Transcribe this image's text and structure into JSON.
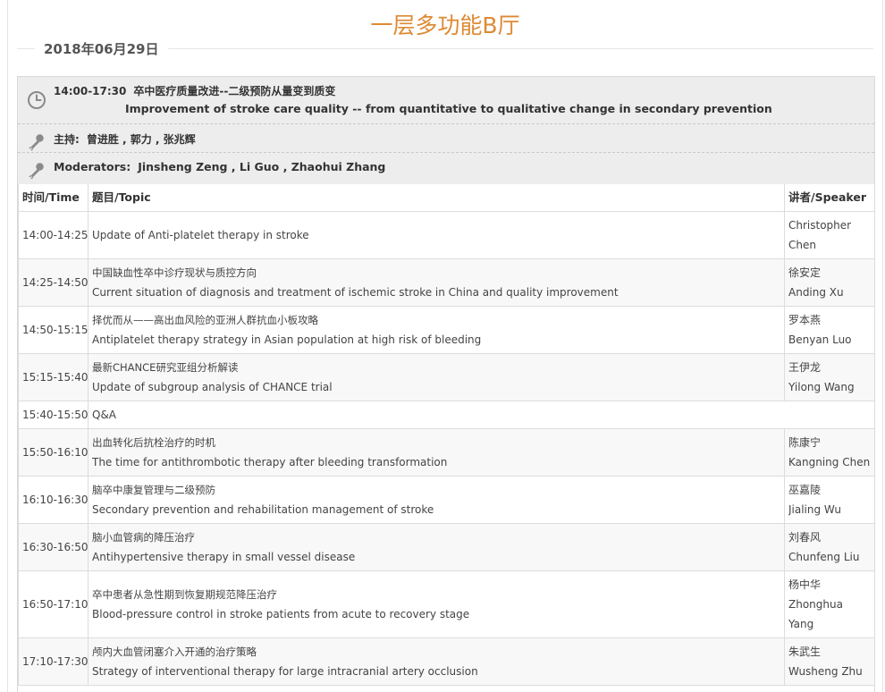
{
  "hall": {
    "title": "一层多功能B厅"
  },
  "date": {
    "label": "2018年06月29日"
  },
  "session": {
    "time": "14:00-17:30",
    "title_cn": "卒中医疗质量改进--二级预防从量变到质变",
    "title_en": "Improvement of stroke care quality -- from quantitative to qualitative change in secondary prevention",
    "host_label": "主持:",
    "hosts_cn": "曾进胜 , 郭力 , 张兆辉",
    "moderators_label": "Moderators:",
    "moderators_en": "Jinsheng Zeng , Li Guo , Zhaohui Zhang",
    "icons": {
      "time": "clock-icon",
      "host": "microphone-icon",
      "moderators": "microphone-icon"
    }
  },
  "table": {
    "headers": {
      "time": "时间/Time",
      "topic": "题目/Topic",
      "speaker": "讲者/Speaker"
    },
    "rows": [
      {
        "time": "14:00-14:25",
        "topic_cn": "",
        "topic_en": "Update of Anti-platelet therapy in stroke",
        "speaker_cn": "",
        "speaker_en": "Christopher Chen"
      },
      {
        "time": "14:25-14:50",
        "topic_cn": "中国缺血性卒中诊疗现状与质控方向",
        "topic_en": "Current situation of diagnosis and treatment of ischemic stroke in China and quality improvement",
        "speaker_cn": "徐安定",
        "speaker_en": "Anding Xu"
      },
      {
        "time": "14:50-15:15",
        "topic_cn": "择优而从——高出血风险的亚洲人群抗血小板攻略",
        "topic_en": "Antiplatelet therapy strategy in Asian population at high risk of bleeding",
        "speaker_cn": "罗本燕",
        "speaker_en": "Benyan Luo"
      },
      {
        "time": "15:15-15:40",
        "topic_cn": "最新CHANCE研究亚组分析解读",
        "topic_en": "Update of subgroup analysis of CHANCE trial",
        "speaker_cn": "王伊龙",
        "speaker_en": "Yilong Wang"
      },
      {
        "time": "15:40-15:50",
        "topic_cn": "",
        "topic_en": "Q&A",
        "speaker_cn": "",
        "speaker_en": ""
      },
      {
        "time": "15:50-16:10",
        "topic_cn": "出血转化后抗栓治疗的时机",
        "topic_en": "The time for antithrombotic therapy after bleeding transformation",
        "speaker_cn": "陈康宁",
        "speaker_en": "Kangning Chen"
      },
      {
        "time": "16:10-16:30",
        "topic_cn": "脑卒中康复管理与二级预防",
        "topic_en": "Secondary prevention and rehabilitation management of stroke",
        "speaker_cn": "巫嘉陵",
        "speaker_en": "Jialing Wu"
      },
      {
        "time": "16:30-16:50",
        "topic_cn": "脑小血管病的降压治疗",
        "topic_en": "Antihypertensive therapy in small vessel disease",
        "speaker_cn": "刘春风",
        "speaker_en": "Chunfeng Liu"
      },
      {
        "time": "16:50-17:10",
        "topic_cn": "卒中患者从急性期到恢复期规范降压治疗",
        "topic_en": "Blood-pressure control in stroke patients from acute to recovery stage",
        "speaker_cn": "杨中华",
        "speaker_en": "Zhonghua Yang"
      },
      {
        "time": "17:10-17:30",
        "topic_cn": "颅内大血管闭塞介入开通的治疗策略",
        "topic_en": "Strategy of interventional therapy for large intracranial artery occlusion",
        "speaker_cn": "朱武生",
        "speaker_en": "Wusheng Zhu"
      }
    ]
  },
  "colors": {
    "title": "#de8a33",
    "info_bg": "#ededed",
    "border": "#dcdcdc"
  }
}
